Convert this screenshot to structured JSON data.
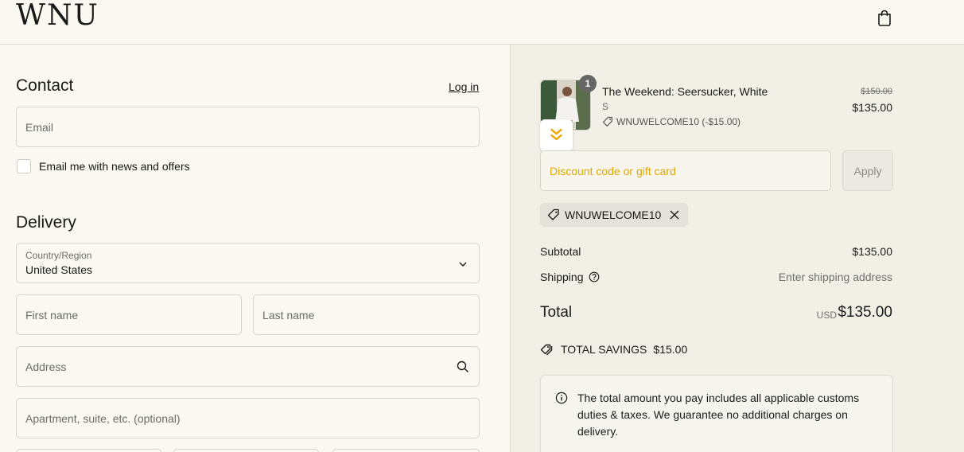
{
  "header": {
    "logo": "WNU",
    "cart_icon": "shopping-bag-icon"
  },
  "contact": {
    "title": "Contact",
    "login_link": "Log in",
    "email_placeholder": "Email",
    "newsletter_label": "Email me with news and offers",
    "newsletter_checked": false
  },
  "delivery": {
    "title": "Delivery",
    "country_label": "Country/Region",
    "country_value": "United States",
    "first_name_placeholder": "First name",
    "last_name_placeholder": "Last name",
    "address_placeholder": "Address",
    "apartment_placeholder": "Apartment, suite, etc. (optional)"
  },
  "order": {
    "item": {
      "name": "The Weekend: Seersucker, White",
      "variant": "S",
      "quantity": "1",
      "discount_line": "WNUWELCOME10 (-$15.00)",
      "original_price": "$150.00",
      "price": "$135.00"
    },
    "discount_placeholder": "Discount code or gift card",
    "apply_label": "Apply",
    "applied_code": "WNUWELCOME10",
    "subtotal_label": "Subtotal",
    "subtotal_value": "$135.00",
    "shipping_label": "Shipping",
    "shipping_value": "Enter shipping address",
    "total_label": "Total",
    "total_currency": "USD",
    "total_value": "$135.00",
    "savings_label": "TOTAL SAVINGS",
    "savings_value": "$15.00",
    "notice": "The total amount you pay includes all applicable customs duties & taxes. We guarantee no additional charges on delivery."
  },
  "colors": {
    "background": "#faf8f0",
    "sidebar": "#f1efe6",
    "placeholder_accent": "#e0a800"
  }
}
